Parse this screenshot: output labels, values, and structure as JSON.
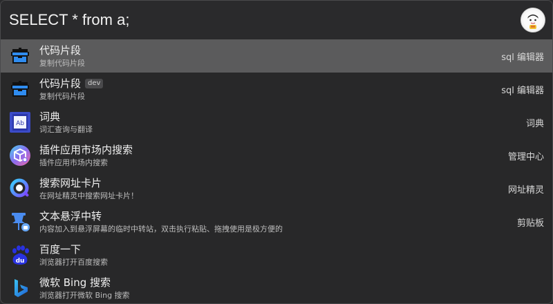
{
  "search": {
    "value": "SELECT * from a;"
  },
  "items": [
    {
      "title": "代码片段",
      "subtitle": "复制代码片段",
      "right": "sql 编辑器",
      "icon": "snippet-box-icon"
    },
    {
      "title": "代码片段",
      "badge": "dev",
      "subtitle": "复制代码片段",
      "right": "sql 编辑器",
      "icon": "snippet-box-icon"
    },
    {
      "title": "词典",
      "subtitle": "词汇查询与翻译",
      "right": "词典",
      "icon": "dictionary-icon"
    },
    {
      "title": "插件应用市场内搜索",
      "subtitle": "插件应用市场内搜索",
      "right": "管理中心",
      "icon": "plugin-market-search-icon"
    },
    {
      "title": "搜索网址卡片",
      "subtitle": "在网址精灵中搜索网址卡片！",
      "right": "网址精灵",
      "icon": "url-search-icon"
    },
    {
      "title": "文本悬浮中转",
      "subtitle": "内容加入到悬浮屏幕的临时中转站，双击执行粘贴、拖拽使用是极方便的",
      "right": "剪贴板",
      "icon": "pin-icon"
    },
    {
      "title": "百度一下",
      "subtitle": "浏览器打开百度搜索",
      "right": "",
      "icon": "baidu-icon"
    },
    {
      "title": "微软 Bing 搜索",
      "subtitle": "浏览器打开微软 Bing 搜索",
      "right": "",
      "icon": "bing-icon"
    }
  ],
  "colors": {
    "selected_row": "#5b5b5c",
    "background": "#282829",
    "snippet_blue": "#2f8cf0",
    "baidu_blue": "#2932e1",
    "bing_blue": "#1f7fd6"
  }
}
